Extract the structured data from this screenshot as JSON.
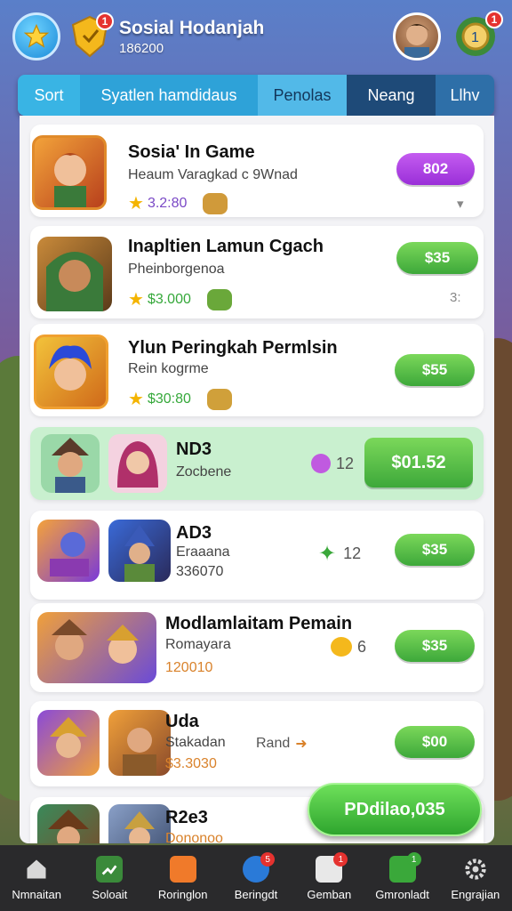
{
  "header": {
    "title": "Sosial Hodanjah",
    "subtitle": "186200",
    "shield_badge": "1",
    "gift_badge": "1"
  },
  "tabs": [
    {
      "label": "Sort"
    },
    {
      "label": "Syatlen hamdidaus"
    },
    {
      "label": "Penolas"
    },
    {
      "label": "Neang"
    },
    {
      "label": "Llhv"
    }
  ],
  "rows": [
    {
      "name": "Sosia' In Game",
      "sub": "Heaum Varagkad c 9Wnad",
      "price": "3.2:80",
      "button": "802"
    },
    {
      "name": "Inapltien Lamun Cgach",
      "sub": "Pheinborgenoa",
      "price": "$3.000",
      "button": "$35",
      "side": "3:"
    },
    {
      "name": "Ylun Peringkah Permlsin",
      "sub": "Rein kogrme",
      "price": "$30:80",
      "button": "$55"
    },
    {
      "name": "ND3",
      "sub": "Zocbene",
      "mid": "12",
      "button": "$01.52"
    },
    {
      "name": "AD3",
      "sub": "Eraaana",
      "extra": "336070",
      "mid": "12",
      "button": "$35"
    },
    {
      "name": "Modlamlaitam Pemain",
      "sub": "Romayara",
      "extra": "120010",
      "mid": "6",
      "button": "$35"
    },
    {
      "name": "Uda",
      "sub": "Stakadan",
      "extra": "$3.3030",
      "mid": "Rand",
      "button": "$00"
    },
    {
      "name": "R2e3",
      "sub": "Dononoo"
    }
  ],
  "cta": "PDdilao,035",
  "nav": [
    {
      "label": "Nmnaitan",
      "icon": "home-icon"
    },
    {
      "label": "Soloait",
      "icon": "chart-icon"
    },
    {
      "label": "Roringlon",
      "icon": "box-icon"
    },
    {
      "label": "Beringdt",
      "icon": "people-icon",
      "badge": "5"
    },
    {
      "label": "Gemban",
      "icon": "dice-icon",
      "badge": "1"
    },
    {
      "label": "Gmronladt",
      "icon": "doc-icon",
      "badge": "1"
    },
    {
      "label": "Engrajian",
      "icon": "gear-icon"
    }
  ],
  "colors": {
    "accent": "#39b4e4",
    "green": "#3da83a",
    "purple": "#9a2fd8"
  }
}
